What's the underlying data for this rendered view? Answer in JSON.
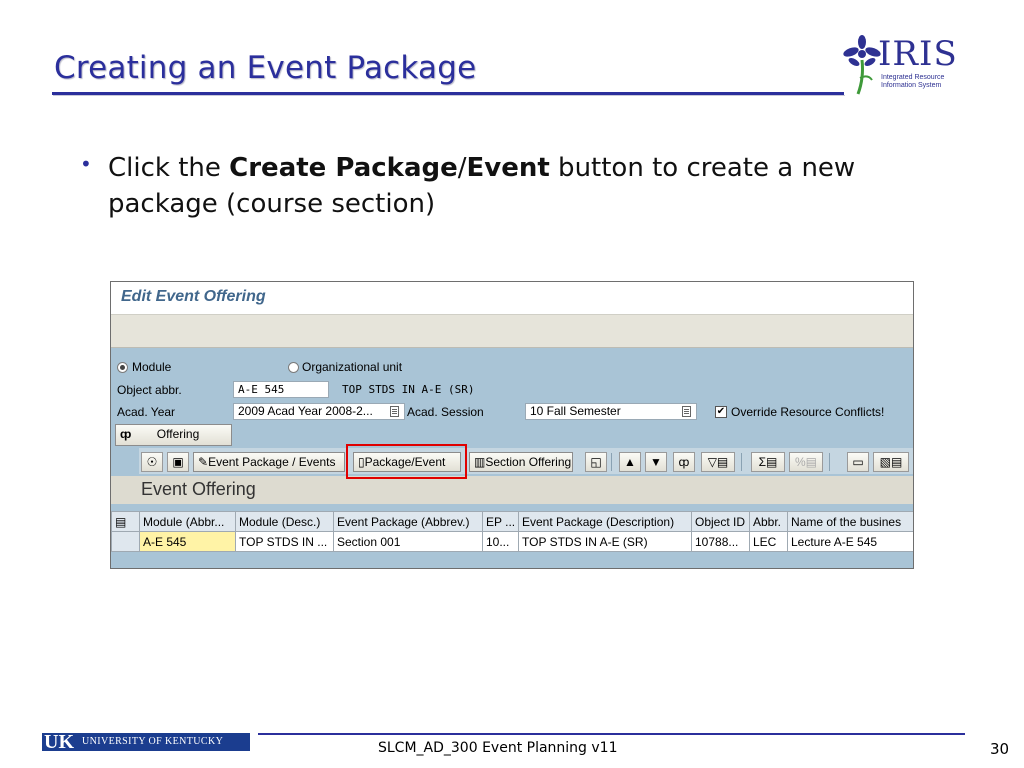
{
  "slide": {
    "title": "Creating an Event Package",
    "bullet": {
      "prefix": "Click the ",
      "bold1": "Create Package",
      "slash": "/",
      "bold2": "Event",
      "suffix": " button to create a new package (course section)"
    }
  },
  "logo": {
    "word": "IRIS",
    "sub1": "Integrated Resource",
    "sub2": "Information System"
  },
  "sap": {
    "title": "Edit Event Offering",
    "radio_module": "Module",
    "radio_org": "Organizational unit",
    "object_abbr_label": "Object abbr.",
    "object_abbr_value": "A-E 545",
    "object_desc": "TOP STDS IN A-E (SR)",
    "acad_year_label": "Acad. Year",
    "acad_year_value": "2009 Acad Year 2008-2...",
    "acad_session_label": "Acad. Session",
    "acad_session_value": "10 Fall Semester",
    "override_label": "Override Resource Conflicts!",
    "offering_button": "Offering",
    "toolbar": {
      "event_package_events": "Event Package / Events",
      "package_event": "Package/Event",
      "section_offering": "Section Offering"
    },
    "panel_title": "Event Offering",
    "grid": {
      "headers": [
        "Module (Abbr...",
        "Module (Desc.)",
        "Event Package (Abbrev.)",
        "EP ...",
        "Event Package (Description)",
        "Object ID",
        "Abbr.",
        "Name of the busines"
      ],
      "rows": [
        [
          "A-E 545",
          "TOP STDS IN ...",
          "Section 001",
          "10...",
          "TOP STDS IN A-E (SR)",
          "10788...",
          "LEC",
          "Lecture A-E 545"
        ]
      ]
    }
  },
  "footer": {
    "uk": "UK",
    "university": "UNIVERSITY OF KENTUCKY",
    "course": "SLCM_AD_300 Event Planning v11",
    "page": "30"
  },
  "colors": {
    "title_blue": "#2b2f9c",
    "highlight_red": "#e00000",
    "sap_bg": "#a9c4d6"
  }
}
